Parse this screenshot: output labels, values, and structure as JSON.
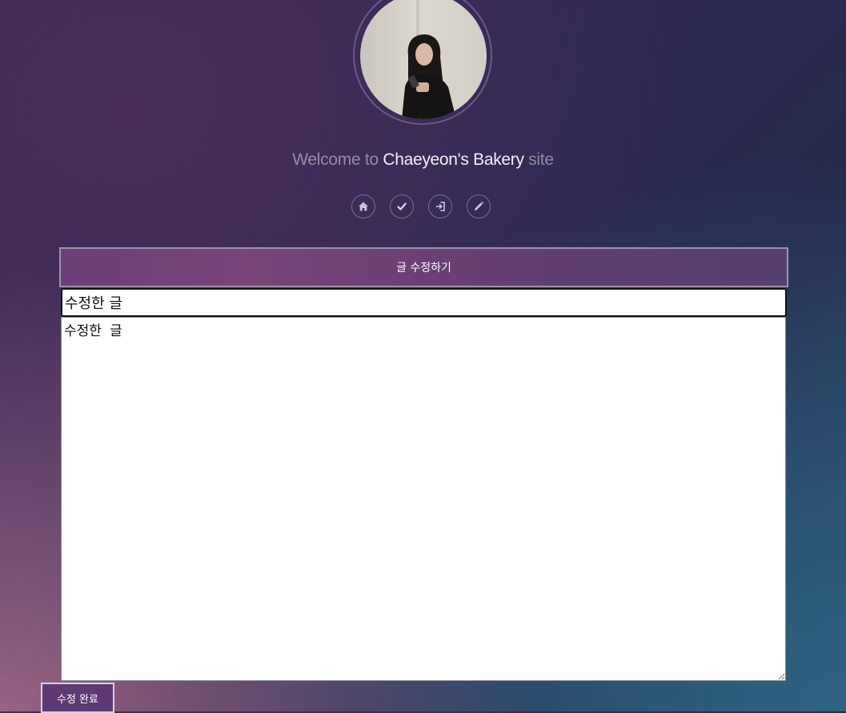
{
  "header": {
    "welcome_prefix": "Welcome to",
    "brand": "Chaeyeon's Bakery",
    "welcome_suffix": "site"
  },
  "nav": {
    "icons": [
      "home-icon",
      "check-icon",
      "sign-in-icon",
      "pencil-icon"
    ]
  },
  "editor": {
    "heading": "글 수정하기",
    "title_value": "수정한 글",
    "body_value": "수정한 글",
    "submit_label": "수정 완료"
  },
  "colors": {
    "header_purple": "#784479",
    "button_purple": "#5e3a72",
    "brand_text": "#f2f0f6"
  }
}
